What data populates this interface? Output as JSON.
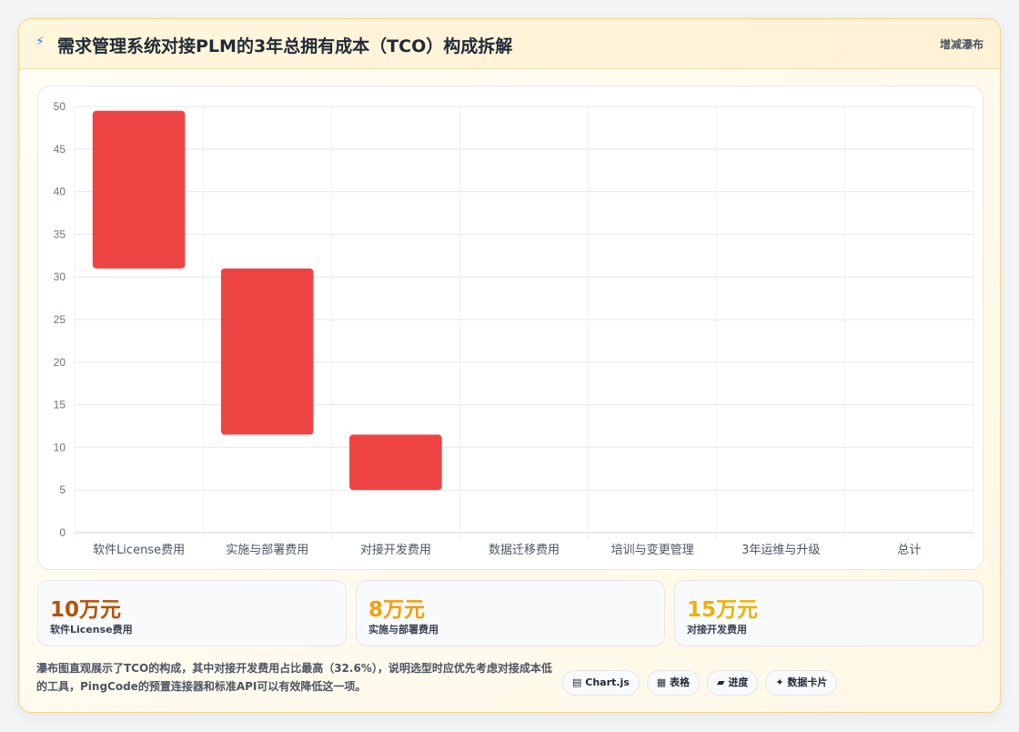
{
  "header": {
    "icon": "bolt-icon",
    "icon_glyph": "⚡",
    "title": "需求管理系统对接PLM的3年总拥有成本（TCO）构成拆解",
    "chart_type_label": "增减瀑布"
  },
  "chart_data": {
    "type": "bar",
    "subtype": "waterfall",
    "categories": [
      "软件License费用",
      "实施与部署费用",
      "对接开发费用",
      "数据迁移费用",
      "培训与变更管理",
      "3年运维与升级",
      "总计"
    ],
    "series": [
      {
        "floating_ranges": [
          [
            31,
            49.5
          ],
          [
            11.5,
            31
          ],
          [
            5,
            11.5
          ],
          null,
          null,
          null,
          null
        ],
        "color": "#ef4444"
      }
    ],
    "title": "",
    "xlabel": "",
    "ylabel": "",
    "ylim": [
      0,
      50
    ],
    "yticks": [
      0,
      5,
      10,
      15,
      20,
      25,
      30,
      35,
      40,
      45,
      50
    ],
    "grid": true,
    "legend": "none"
  },
  "stats": [
    {
      "value": "10万元",
      "label": "软件License费用",
      "color": "#b45309"
    },
    {
      "value": "8万元",
      "label": "实施与部署费用",
      "color": "#f59e0b"
    },
    {
      "value": "15万元",
      "label": "对接开发费用",
      "color": "#eab308"
    }
  ],
  "note": "瀑布图直观展示了TCO的构成，其中对接开发费用占比最高（32.6%），说明选型时应优先考虑对接成本低的工具，PingCode的预置连接器和标准API可以有效降低这一项。",
  "tags": [
    {
      "icon": "chart-icon",
      "glyph": "▤",
      "label": "Chart.js"
    },
    {
      "icon": "table-icon",
      "glyph": "▦",
      "label": "表格"
    },
    {
      "icon": "progress-icon",
      "glyph": "▰",
      "label": "进度"
    },
    {
      "icon": "card-icon",
      "glyph": "✦",
      "label": "数据卡片"
    }
  ]
}
